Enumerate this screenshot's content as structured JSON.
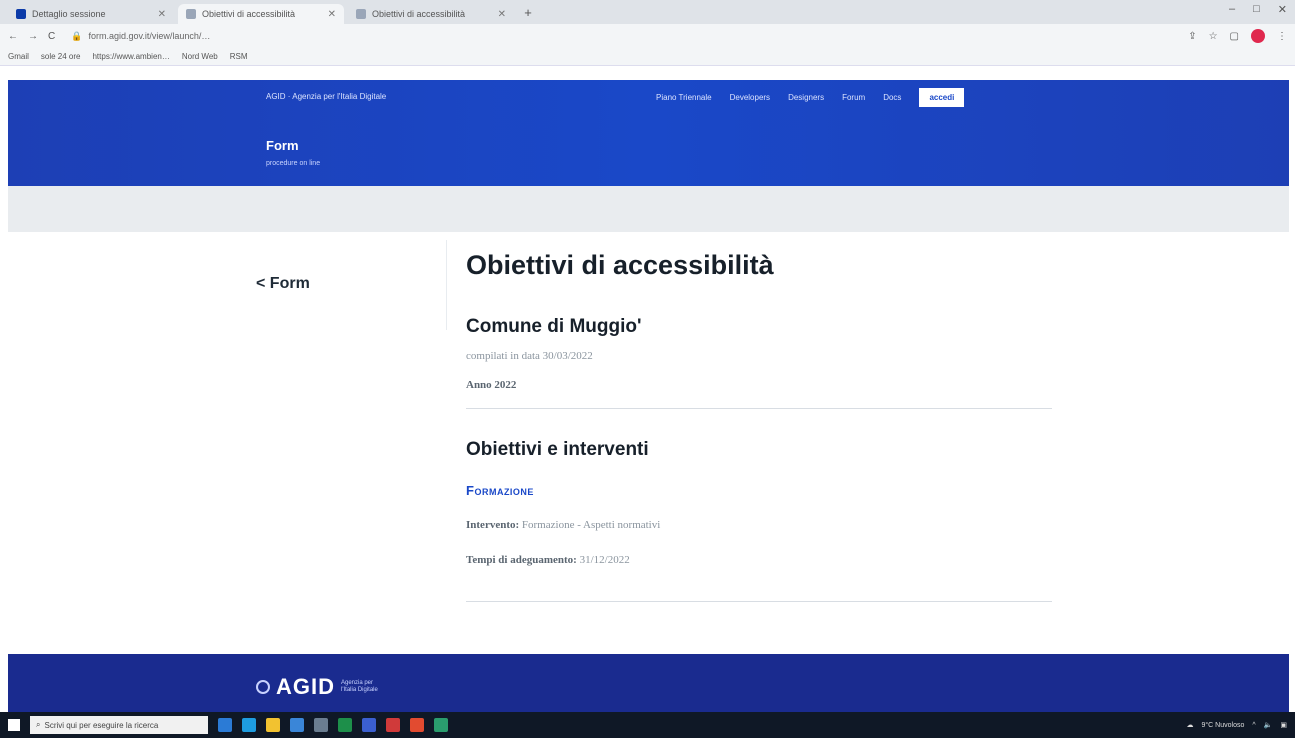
{
  "browser": {
    "tabs": [
      {
        "label": "Dettaglio sessione",
        "active": false
      },
      {
        "label": "Obiettivi di accessibilità",
        "active": true
      },
      {
        "label": "Obiettivi di accessibilità",
        "active": false
      }
    ],
    "new_tab": "+",
    "window_controls": {
      "minimize": "–",
      "maximize": "□",
      "close": "✕"
    },
    "address": "form.agid.gov.it/view/launch/…",
    "nav": {
      "back": "←",
      "forward": "→",
      "reload": "C"
    },
    "bookmarks": [
      "Gmail",
      "sole 24 ore",
      "https://www.ambien…",
      "Nord Web",
      "RSM"
    ]
  },
  "site_header": {
    "org": "AGID · Agenzia per l'Italia Digitale",
    "nav": [
      "Piano Triennale",
      "Developers",
      "Designers",
      "Forum",
      "Docs"
    ],
    "login": "accedi",
    "title": "Form",
    "subtitle": "procedure on line"
  },
  "content": {
    "back_link": "< Form",
    "title": "Obiettivi di accessibilità",
    "entity": "Comune di Muggio'",
    "compiled_date": "compilati in data 30/03/2022",
    "year": "Anno 2022",
    "section_title": "Obiettivi e interventi",
    "category": "Formazione",
    "intervento_label": "Intervento:",
    "intervento_value": "Formazione - Aspetti normativi",
    "tempi_label": "Tempi di adeguamento:",
    "tempi_value": "31/12/2022"
  },
  "footer": {
    "logo": "AGID",
    "logo_sub": "Agenzia per l'Italia Digitale"
  },
  "taskbar": {
    "search_placeholder": "Scrivi qui per eseguire la ricerca",
    "weather": "9°C Nuvoloso"
  },
  "colors": {
    "header_blue": "#1a48c8",
    "footer_blue": "#1a2b8f",
    "accent": "#1a48c8"
  }
}
